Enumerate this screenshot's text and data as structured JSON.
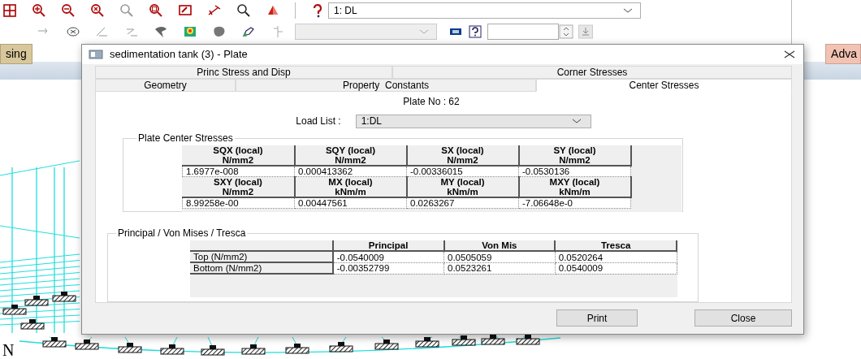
{
  "toolbar": {
    "load_case_select": {
      "value": "1: DL"
    },
    "view_select": {
      "disabled": true
    }
  },
  "ribbon": {
    "left_tab": "sing",
    "right_tab": "Adva"
  },
  "canvas": {
    "compass_label": "N"
  },
  "dialog": {
    "title": "sedimentation tank (3) - Plate",
    "tab_rows": [
      [
        {
          "label": "Princ Stress and Disp",
          "selected": false
        },
        {
          "label": "Corner Stresses",
          "selected": false
        }
      ],
      [
        {
          "label": "Geometry",
          "selected": false
        },
        {
          "label": "Property  Constants",
          "selected": false
        },
        {
          "label": "Center Stresses",
          "selected": true
        }
      ]
    ],
    "plate_no": "Plate No : 62",
    "load_list": {
      "label": "Load List :",
      "value": "1:DL"
    },
    "center_stresses": {
      "title": "Plate Center Stresses",
      "blocks": [
        {
          "headers": [
            {
              "name": "SQX (local)",
              "unit": "N/mm2"
            },
            {
              "name": "SQY (local)",
              "unit": "N/mm2"
            },
            {
              "name": "SX (local)",
              "unit": "N/mm2"
            },
            {
              "name": "SY (local)",
              "unit": "N/mm2"
            }
          ],
          "values": [
            "1.6977e-008",
            "0.000413362",
            "-0.00336015",
            "-0.0530136"
          ]
        },
        {
          "headers": [
            {
              "name": "SXY (local)",
              "unit": "N/mm2"
            },
            {
              "name": "MX (local)",
              "unit": "kNm/m"
            },
            {
              "name": "MY (local)",
              "unit": "kNm/m"
            },
            {
              "name": "MXY (local)",
              "unit": "kNm/m"
            }
          ],
          "values": [
            "8.99258e-00",
            "0.00447561",
            "0.0263267",
            "-7.06648e-0"
          ]
        }
      ]
    },
    "principal": {
      "title": "Principal / Von Mises / Tresca",
      "columns": [
        "Principal",
        "Von Mis",
        "Tresca"
      ],
      "rows": [
        {
          "label": "Top (N/mm2)",
          "values": [
            "-0.0540009",
            "0.0505059",
            "0.0520264"
          ]
        },
        {
          "label": "Bottom (N/mm2)",
          "values": [
            "-0.00352799",
            "0.0523261",
            "0.0540009"
          ]
        }
      ]
    },
    "buttons": [
      "Print",
      "Close"
    ]
  }
}
